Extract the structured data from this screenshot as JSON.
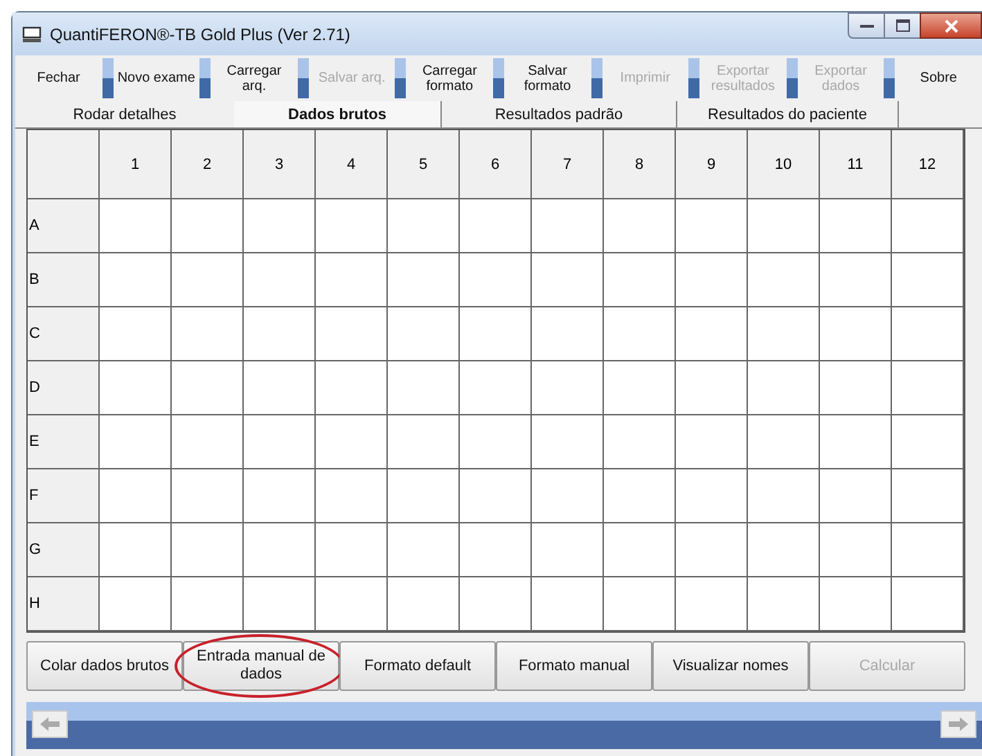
{
  "window": {
    "title": "QuantiFERON®-TB Gold Plus (Ver 2.71)"
  },
  "toolbar": [
    {
      "label": "Fechar",
      "disabled": false
    },
    {
      "label": "Novo exame",
      "disabled": false
    },
    {
      "label": "Carregar arq.",
      "disabled": false
    },
    {
      "label": "Salvar arq.",
      "disabled": true
    },
    {
      "label": "Carregar formato",
      "disabled": false
    },
    {
      "label": "Salvar formato",
      "disabled": false
    },
    {
      "label": "Imprimir",
      "disabled": true
    },
    {
      "label": "Exportar resultados",
      "disabled": true
    },
    {
      "label": "Exportar dados",
      "disabled": true
    },
    {
      "label": "Sobre",
      "disabled": false
    }
  ],
  "tabs": [
    {
      "label": "Rodar detalhes",
      "selected": false
    },
    {
      "label": "Dados brutos",
      "selected": true
    },
    {
      "label": "Resultados padrão",
      "selected": false
    },
    {
      "label": "Resultados do paciente",
      "selected": false
    }
  ],
  "plate": {
    "columns": [
      "1",
      "2",
      "3",
      "4",
      "5",
      "6",
      "7",
      "8",
      "9",
      "10",
      "11",
      "12"
    ],
    "rows": [
      "A",
      "B",
      "C",
      "D",
      "E",
      "F",
      "G",
      "H"
    ]
  },
  "actions": [
    {
      "label": "Colar dados brutos",
      "disabled": false,
      "highlighted": false
    },
    {
      "label": "Entrada manual de dados",
      "disabled": false,
      "highlighted": true
    },
    {
      "label": "Formato default",
      "disabled": false,
      "highlighted": false
    },
    {
      "label": "Formato manual",
      "disabled": false,
      "highlighted": false
    },
    {
      "label": "Visualizar nomes",
      "disabled": false,
      "highlighted": false
    },
    {
      "label": "Calcular",
      "disabled": true,
      "highlighted": false
    }
  ]
}
